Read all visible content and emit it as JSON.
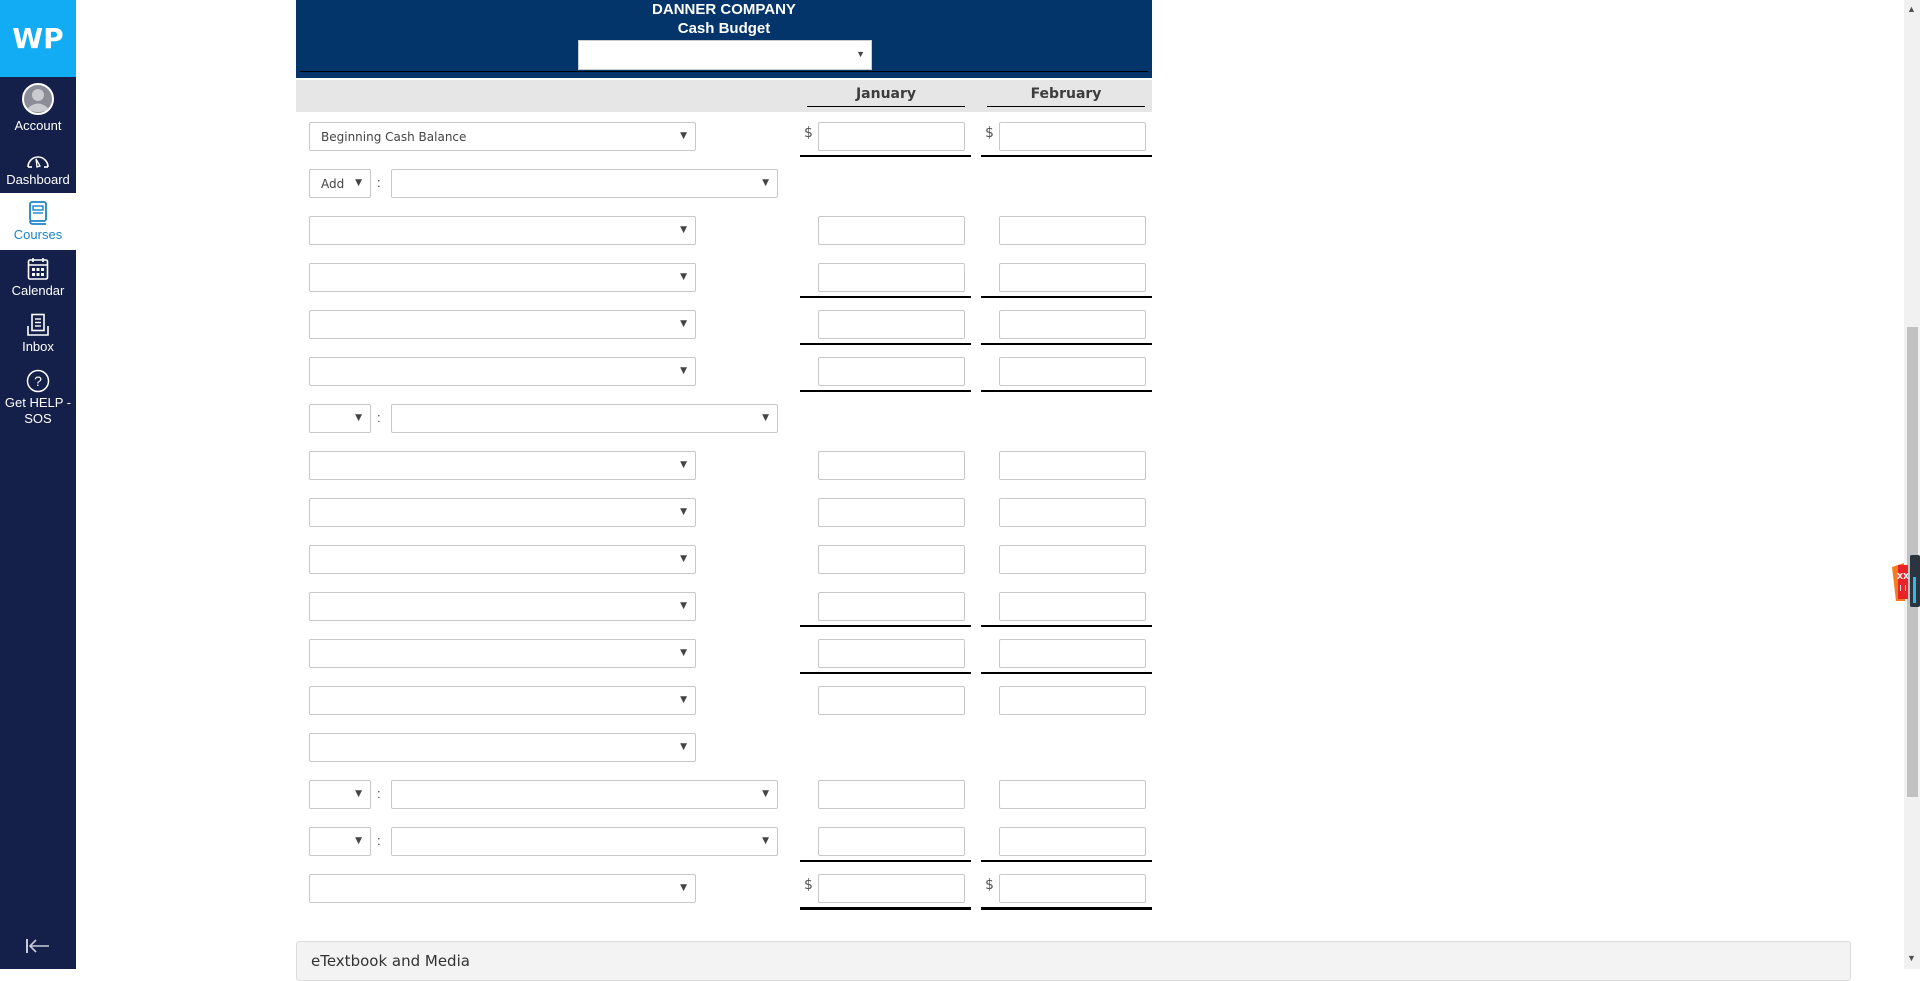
{
  "sidebar": {
    "logo": "WP",
    "items": [
      {
        "label": "Account",
        "icon": "account-icon"
      },
      {
        "label": "Dashboard",
        "icon": "dashboard-icon"
      },
      {
        "label": "Courses",
        "icon": "courses-icon",
        "active": true
      },
      {
        "label": "Calendar",
        "icon": "calendar-icon"
      },
      {
        "label": "Inbox",
        "icon": "inbox-icon"
      },
      {
        "label": "Get HELP - SOS",
        "icon": "help-icon"
      }
    ],
    "collapse_icon": "collapse-arrow-icon"
  },
  "header": {
    "company": "DANNER COMPANY",
    "title": "Cash Budget",
    "period_select": {
      "value": ""
    }
  },
  "columns": [
    "January",
    "February"
  ],
  "rows": [
    {
      "type": "label-select",
      "value": "Beginning Cash Balance",
      "dollar": true,
      "inputs": true,
      "underline": "single"
    },
    {
      "type": "op-select",
      "op": "Add",
      "value": "",
      "inputs": false
    },
    {
      "type": "label-select",
      "value": "",
      "inputs": true
    },
    {
      "type": "label-select",
      "value": "",
      "inputs": true,
      "underline": "single"
    },
    {
      "type": "label-select",
      "value": "",
      "inputs": true,
      "underline": "single"
    },
    {
      "type": "label-select",
      "value": "",
      "inputs": true,
      "underline": "single"
    },
    {
      "type": "op-select",
      "op": "",
      "value": "",
      "inputs": false
    },
    {
      "type": "label-select",
      "value": "",
      "inputs": true
    },
    {
      "type": "label-select",
      "value": "",
      "inputs": true
    },
    {
      "type": "label-select",
      "value": "",
      "inputs": true
    },
    {
      "type": "label-select",
      "value": "",
      "inputs": true,
      "underline": "single"
    },
    {
      "type": "label-select",
      "value": "",
      "inputs": true,
      "underline": "single"
    },
    {
      "type": "label-select",
      "value": "",
      "inputs": true
    },
    {
      "type": "label-select",
      "value": "",
      "inputs": false
    },
    {
      "type": "op-select",
      "op": "",
      "value": "",
      "inputs": true
    },
    {
      "type": "op-select",
      "op": "",
      "value": "",
      "inputs": true,
      "underline": "single"
    },
    {
      "type": "label-select",
      "value": "",
      "dollar": true,
      "inputs": true,
      "underline": "double"
    }
  ],
  "dollar_sign": "$",
  "colon": ":",
  "footer": {
    "etextbook": "eTextbook and Media"
  }
}
